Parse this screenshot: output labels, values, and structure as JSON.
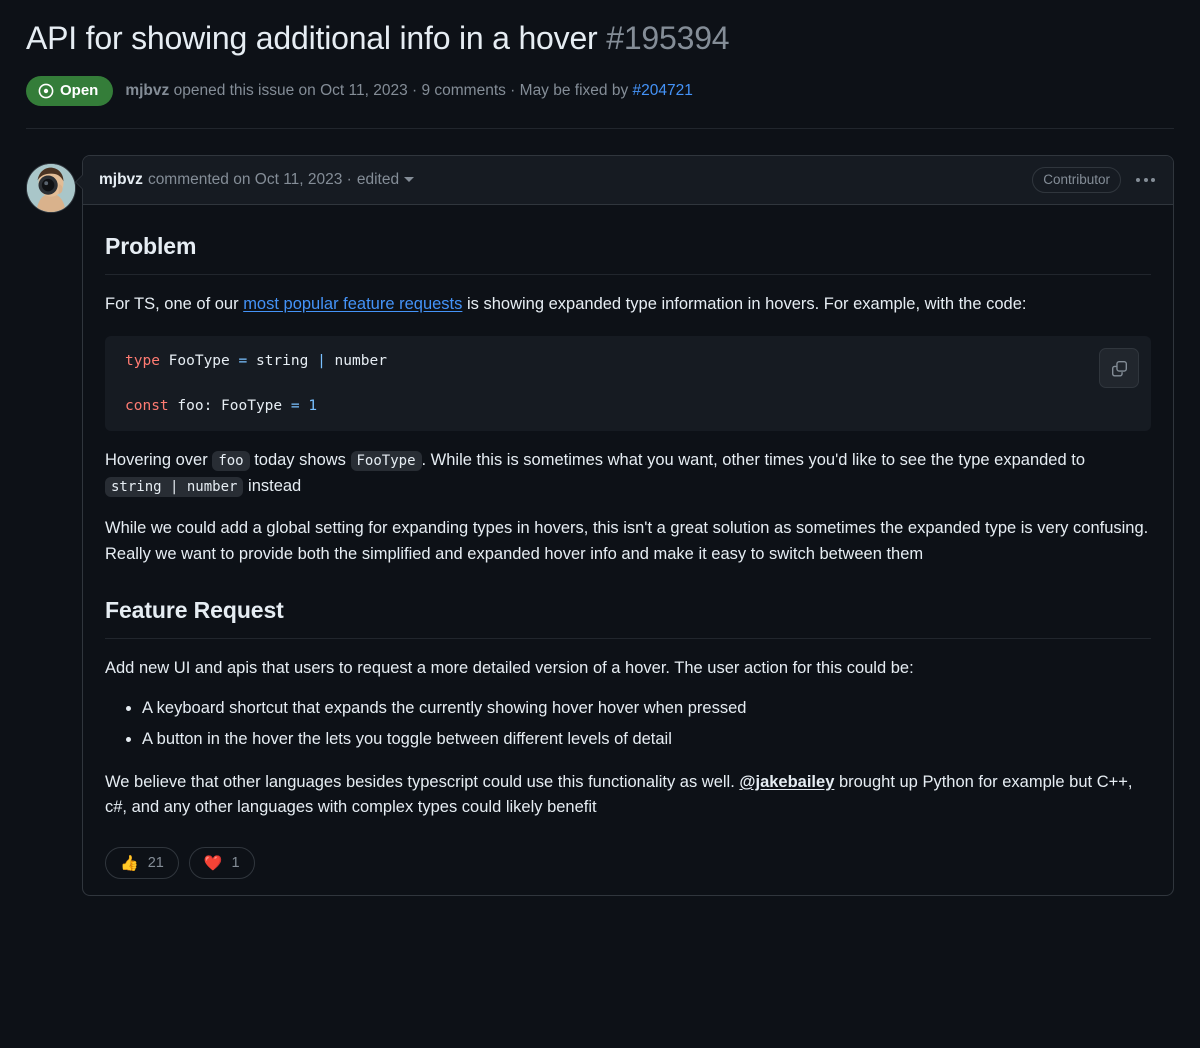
{
  "issue": {
    "title": "API for showing additional info in a hover",
    "number": "#195394",
    "state_label": "Open",
    "state_color": "#347d39",
    "meta_author": "mjbvz",
    "meta_opened": " opened this issue on Oct 11, 2023 · 9 comments · May be fixed by ",
    "meta_fix_link": "#204721"
  },
  "comment": {
    "author": "mjbvz",
    "when": "commented on Oct 11, 2023 ·",
    "edited_label": "edited",
    "role_badge": "Contributor",
    "menu_icon": "kebab-horizontal-icon",
    "avatar_icon": "user-avatar"
  },
  "body": {
    "heading_problem": "Problem",
    "p1_before": "For TS, one of our ",
    "p1_link": "most popular feature requests",
    "p1_after": " is showing expanded type information in hovers. For example, with the code:",
    "code": {
      "copy_icon": "copy-icon",
      "line1": [
        {
          "t": "type",
          "c": "kw"
        },
        {
          "t": " FooType ",
          "c": "txt"
        },
        {
          "t": "=",
          "c": "op"
        },
        {
          "t": " string ",
          "c": "txt"
        },
        {
          "t": "|",
          "c": "op"
        },
        {
          "t": " number",
          "c": "txt"
        }
      ],
      "line2": [
        {
          "t": "const",
          "c": "kw"
        },
        {
          "t": " foo: FooType ",
          "c": "txt"
        },
        {
          "t": "=",
          "c": "op"
        },
        {
          "t": " ",
          "c": "txt"
        },
        {
          "t": "1",
          "c": "num"
        }
      ]
    },
    "p2_a": "Hovering over ",
    "p2_code1": "foo",
    "p2_b": " today shows ",
    "p2_code2": "FooType",
    "p2_c": ". While this is sometimes what you want, other times you'd like to see the type expanded to ",
    "p2_code3": "string | number",
    "p2_d": " instead",
    "p3": "While we could add a global setting for expanding types in hovers, this isn't a great solution as sometimes the expanded type is very confusing. Really we want to provide both the simplified and expanded hover info and make it easy to switch between them",
    "heading_feature": "Feature Request",
    "p4": "Add new UI and apis that users to request a more detailed version of a hover. The user action for this could be:",
    "bullets": [
      "A keyboard shortcut that expands the currently showing hover hover when pressed",
      "A button in the hover the lets you toggle between different levels of detail"
    ],
    "p5_a": "We believe that other languages besides typescript could use this functionality as well. ",
    "p5_mention": "@jakebailey",
    "p5_b": " brought up Python for example but C++, c#, and any other languages with complex types could likely benefit"
  },
  "reactions": [
    {
      "emoji": "👍",
      "name": "thumbs-up",
      "count": "21"
    },
    {
      "emoji": "❤️",
      "name": "heart",
      "count": "1"
    }
  ]
}
